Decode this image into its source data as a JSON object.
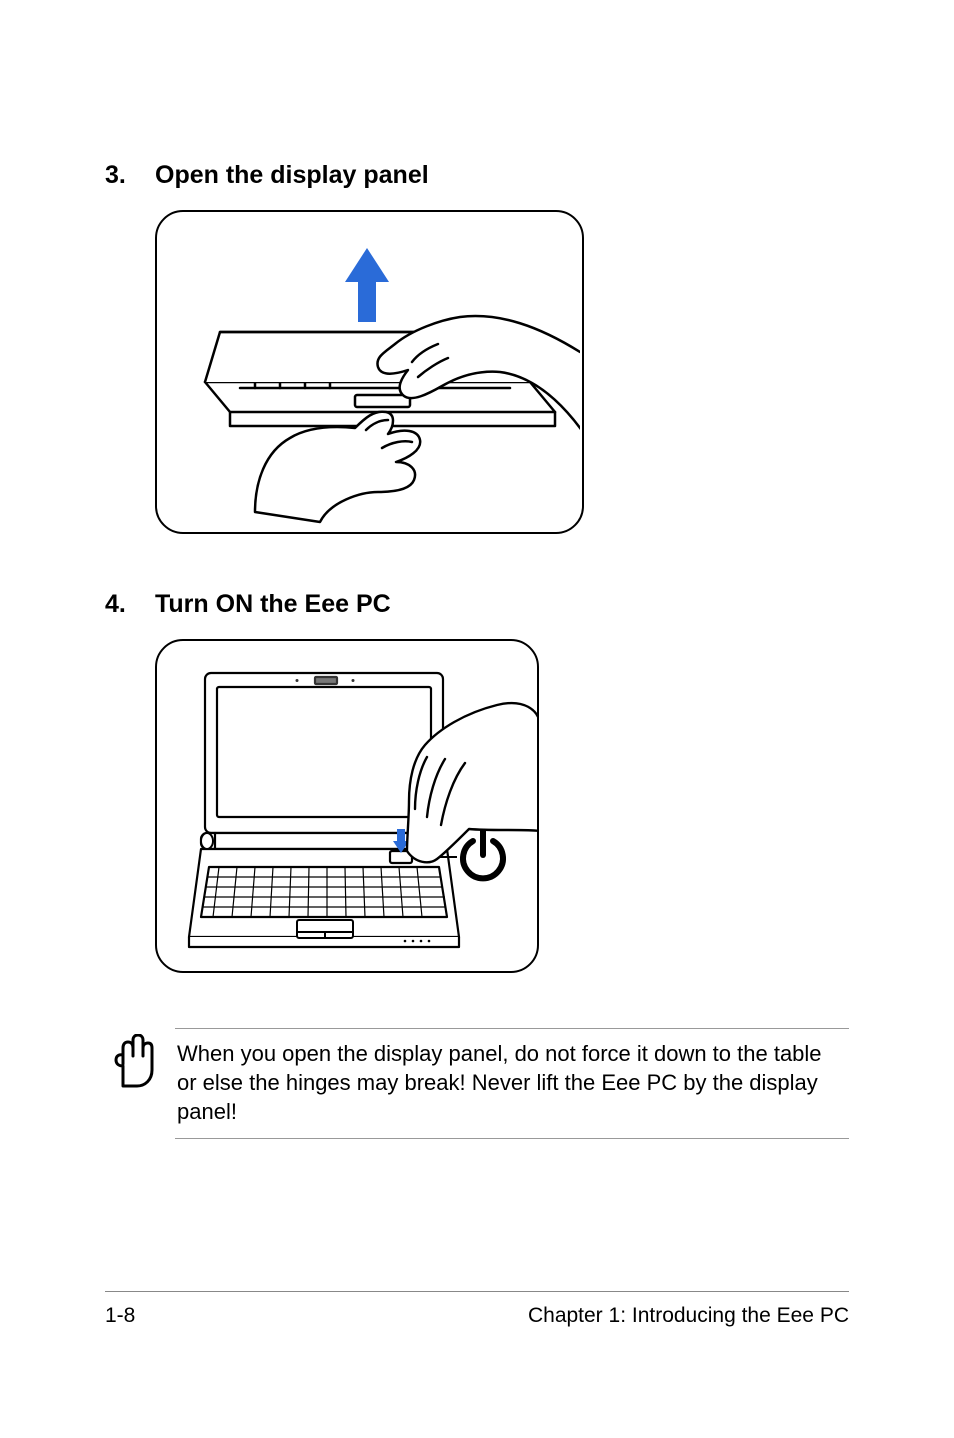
{
  "steps": [
    {
      "number": "3.",
      "title": "Open the display panel"
    },
    {
      "number": "4.",
      "title": "Turn ON the Eee PC"
    }
  ],
  "note": {
    "text": "When you open the display panel, do not force it down to the table or else the hinges may break! Never lift the Eee PC by the display panel!"
  },
  "footer": {
    "page_number": "1-8",
    "chapter_label": "Chapter 1: Introducing the Eee PC"
  }
}
